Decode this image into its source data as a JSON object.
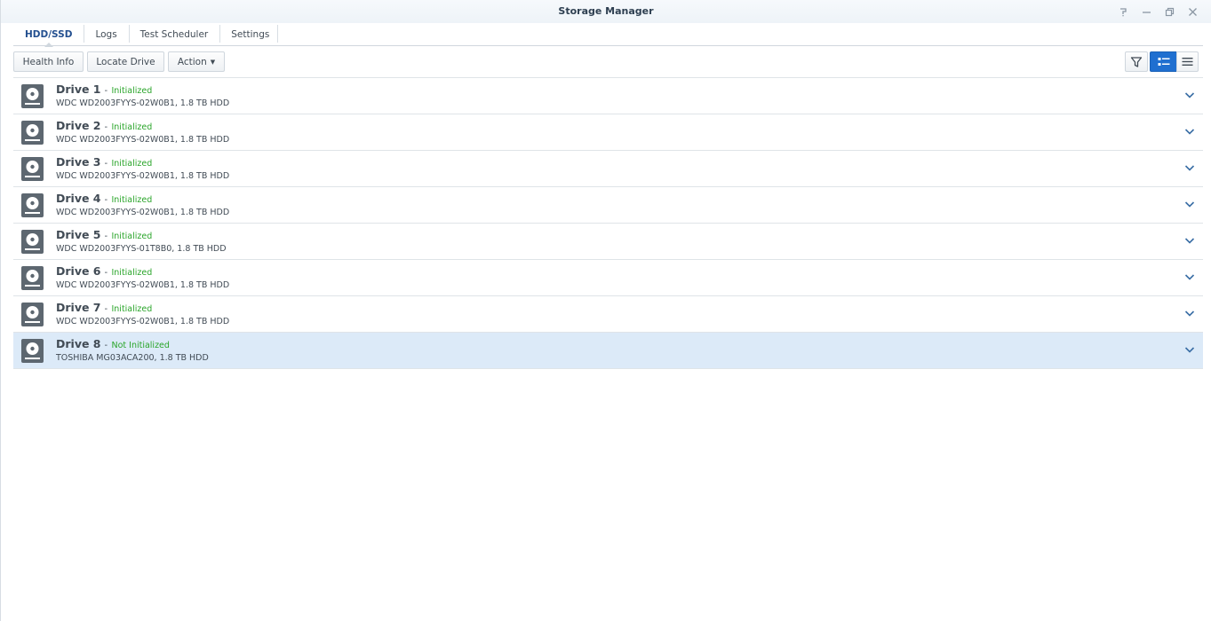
{
  "window": {
    "title": "Storage Manager",
    "controls": [
      "help-icon",
      "minimize-icon",
      "restore-icon",
      "close-icon"
    ]
  },
  "tabs": [
    {
      "label": "HDD/SSD",
      "active": true
    },
    {
      "label": "Logs",
      "active": false
    },
    {
      "label": "Test Scheduler",
      "active": false
    },
    {
      "label": "Settings",
      "active": false
    }
  ],
  "toolbar": {
    "health_info": "Health Info",
    "locate_drive": "Locate Drive",
    "action": "Action",
    "view_icons": [
      "filter-icon",
      "list-detail-icon",
      "list-compact-icon"
    ],
    "active_view": "list-detail-icon"
  },
  "colors": {
    "accent": "#1f6fd0",
    "status_ok": "#2aa52a",
    "selected_row": "#dceaf8",
    "active_tab": "#245090"
  },
  "drives": [
    {
      "name": "Drive 1",
      "sep": "-",
      "status": "Initialized",
      "desc": "WDC WD2003FYYS-02W0B1, 1.8 TB HDD",
      "selected": false
    },
    {
      "name": "Drive 2",
      "sep": "-",
      "status": "Initialized",
      "desc": "WDC WD2003FYYS-02W0B1, 1.8 TB HDD",
      "selected": false
    },
    {
      "name": "Drive 3",
      "sep": "-",
      "status": "Initialized",
      "desc": "WDC WD2003FYYS-02W0B1, 1.8 TB HDD",
      "selected": false
    },
    {
      "name": "Drive 4",
      "sep": "-",
      "status": "Initialized",
      "desc": "WDC WD2003FYYS-02W0B1, 1.8 TB HDD",
      "selected": false
    },
    {
      "name": "Drive 5",
      "sep": "-",
      "status": "Initialized",
      "desc": "WDC WD2003FYYS-01T8B0, 1.8 TB HDD",
      "selected": false
    },
    {
      "name": "Drive 6",
      "sep": "-",
      "status": "Initialized",
      "desc": "WDC WD2003FYYS-02W0B1, 1.8 TB HDD",
      "selected": false
    },
    {
      "name": "Drive 7",
      "sep": "-",
      "status": "Initialized",
      "desc": "WDC WD2003FYYS-02W0B1, 1.8 TB HDD",
      "selected": false
    },
    {
      "name": "Drive 8",
      "sep": "-",
      "status": "Not Initialized",
      "desc": "TOSHIBA MG03ACA200, 1.8 TB HDD",
      "selected": true
    }
  ]
}
